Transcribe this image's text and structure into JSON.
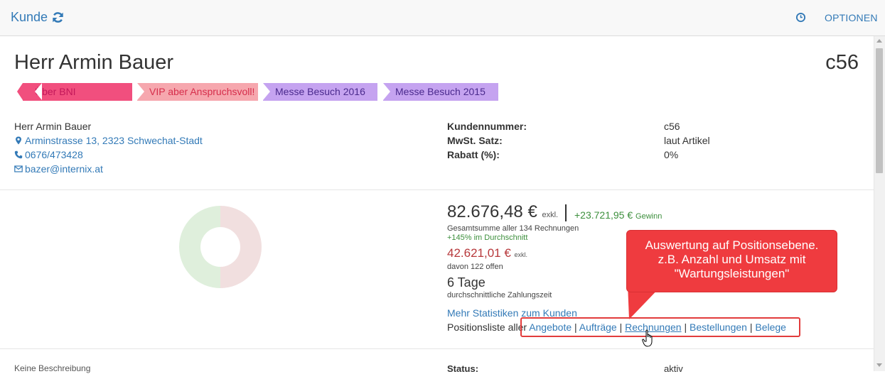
{
  "topbar": {
    "title": "Kunde",
    "options_label": "OPTIONEN"
  },
  "customer": {
    "name": "Herr Armin Bauer",
    "code": "c56"
  },
  "tags": [
    {
      "label": "Über BNI",
      "color": "#f14f7e"
    },
    {
      "label": "VIP aber Anspruchsvoll!",
      "color": "#f6a7ae"
    },
    {
      "label": "Messe Besuch 2016",
      "color": "#c5a3f0"
    },
    {
      "label": "Messe Besuch 2015",
      "color": "#c5a3f0"
    }
  ],
  "contact": {
    "name": "Herr Armin Bauer",
    "address": "Arminstrasse 13, 2323 Schwechat-Stadt",
    "phone": "0676/473428",
    "email": "bazer@internix.at"
  },
  "details": [
    {
      "key": "Kundennummer:",
      "value": "c56"
    },
    {
      "key": "MwSt. Satz:",
      "value": "laut Artikel"
    },
    {
      "key": "Rabatt (%):",
      "value": "0%"
    }
  ],
  "stats": {
    "total": "82.676,48 €",
    "total_suffix": "exkl.",
    "gain": "+23.721,95 €",
    "gain_label": "Gewinn",
    "total_desc": "Gesamtsumme aller 134 Rechnungen",
    "avg_desc": "+145% im Durchschnitt",
    "open": "42.621,01 €",
    "open_suffix": "exkl.",
    "open_desc": "davon 122 offen",
    "days": "6 Tage",
    "days_desc": "durchschnittliche Zahlungszeit",
    "more_link": "Mehr Statistiken zum Kunden",
    "poslist_prefix": "Positionsliste aller",
    "poslist_links": [
      "Angebote",
      "Aufträge",
      "Rechnungen",
      "Bestellungen",
      "Belege"
    ],
    "donut_share": 0.5
  },
  "callout": {
    "line1": "Auswertung auf Positionsebene.",
    "line2": "z.B. Anzahl und Umsatz mit",
    "line3": "\"Wartungsleistungen\""
  },
  "bottom": {
    "description": "Keine Beschreibung",
    "status_key": "Status:",
    "status_value": "aktiv"
  }
}
